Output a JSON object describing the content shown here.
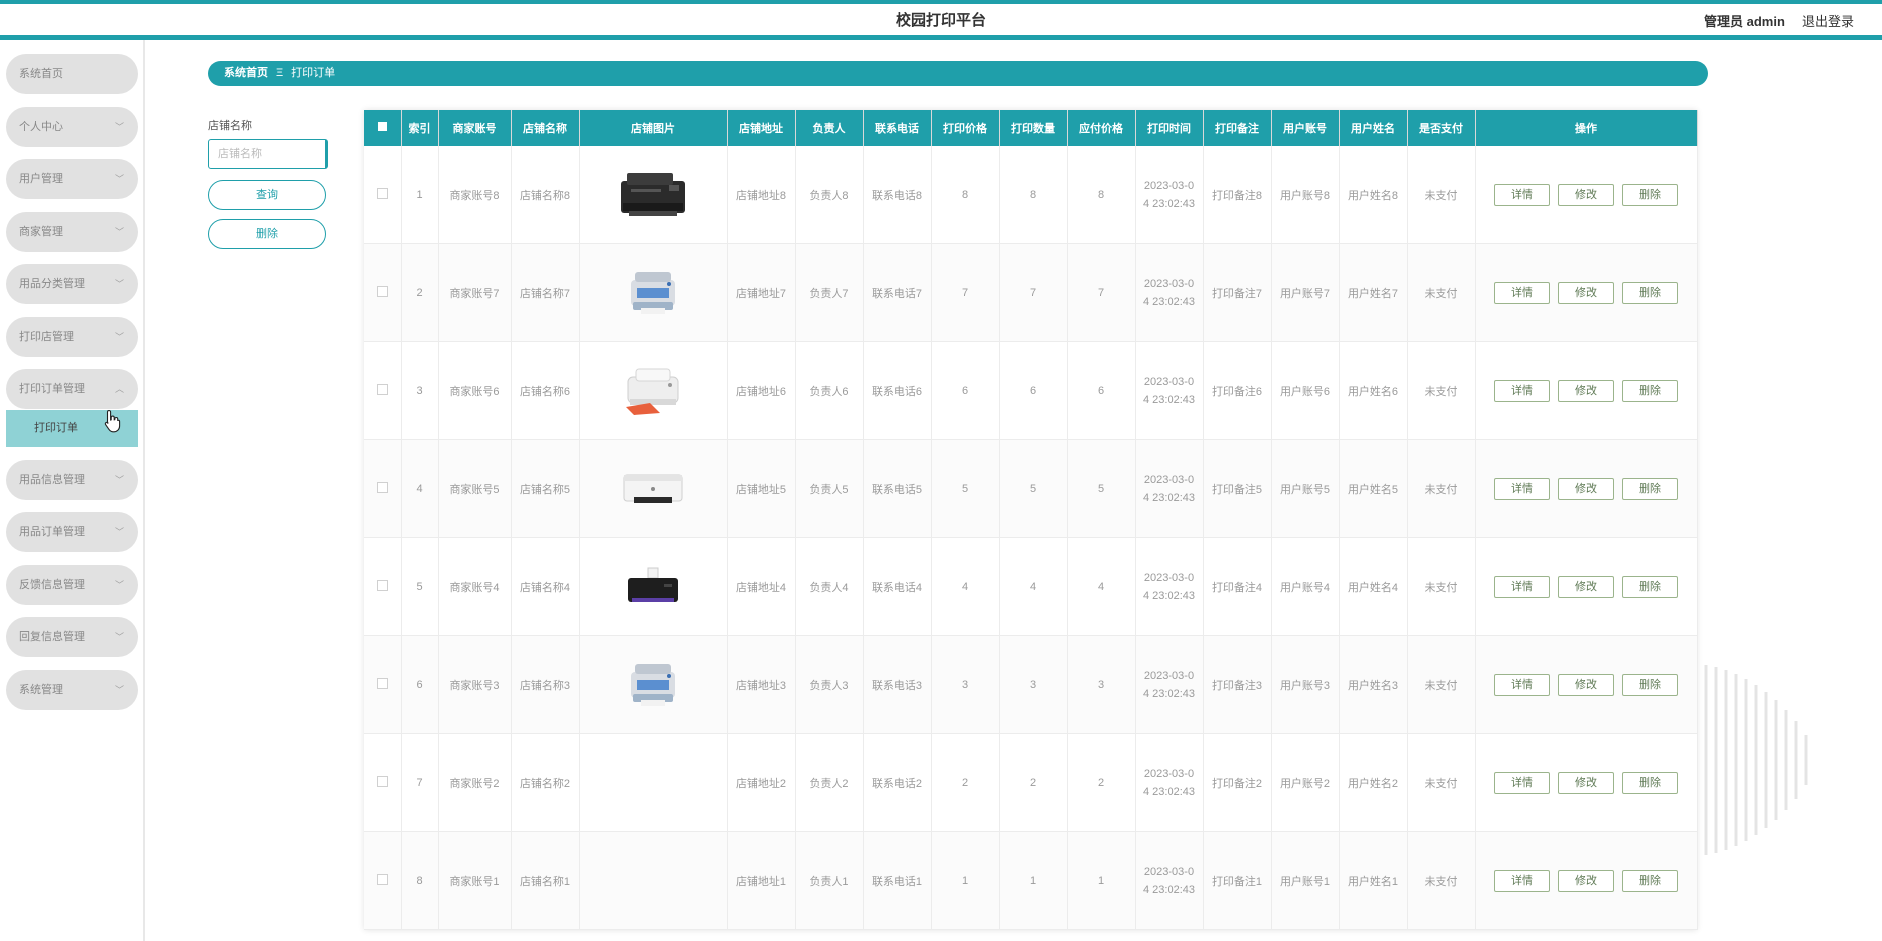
{
  "header": {
    "title": "校园打印平台",
    "user": "管理员 admin",
    "logout": "退出登录"
  },
  "colors": {
    "accent": "#1f9faa",
    "submenu_active": "#8fd2d5"
  },
  "sidebar": {
    "items": [
      {
        "label": "系统首页",
        "has_chevron": false
      },
      {
        "label": "个人中心",
        "has_chevron": true
      },
      {
        "label": "用户管理",
        "has_chevron": true
      },
      {
        "label": "商家管理",
        "has_chevron": true
      },
      {
        "label": "用品分类管理",
        "has_chevron": true
      },
      {
        "label": "打印店管理",
        "has_chevron": true
      },
      {
        "label": "打印订单管理",
        "has_chevron": true,
        "expanded": true
      },
      {
        "label": "用品信息管理",
        "has_chevron": true
      },
      {
        "label": "用品订单管理",
        "has_chevron": true
      },
      {
        "label": "反馈信息管理",
        "has_chevron": true
      },
      {
        "label": "回复信息管理",
        "has_chevron": true
      },
      {
        "label": "系统管理",
        "has_chevron": true
      }
    ],
    "submenu": {
      "label": "打印订单"
    }
  },
  "breadcrumb": {
    "home": "系统首页",
    "separator": "Ξ",
    "current": "打印订单"
  },
  "search": {
    "label": "店铺名称",
    "placeholder": "店铺名称",
    "query_button": "查询",
    "delete_button": "删除"
  },
  "table": {
    "columns": [
      "",
      "索引",
      "商家账号",
      "店铺名称",
      "店铺图片",
      "店铺地址",
      "负责人",
      "联系电话",
      "打印价格",
      "打印数量",
      "应付价格",
      "打印时间",
      "打印备注",
      "用户账号",
      "用户姓名",
      "是否支付",
      "操作"
    ],
    "actions": [
      "详情",
      "修改",
      "删除"
    ],
    "rows": [
      {
        "index": "1",
        "merchant": "商家账号8",
        "shop": "店铺名称8",
        "image": "printer-black-inkjet-icon",
        "address": "店铺地址8",
        "manager": "负责人8",
        "phone": "联系电话8",
        "price": "8",
        "qty": "8",
        "due": "8",
        "time1": "2023-03-0",
        "time2": "4 23:02:43",
        "note": "打印备注8",
        "user_account": "用户账号8",
        "user_name": "用户姓名8",
        "paid": "未支付"
      },
      {
        "index": "2",
        "merchant": "商家账号7",
        "shop": "店铺名称7",
        "image": "printer-blue-multifunction-icon",
        "address": "店铺地址7",
        "manager": "负责人7",
        "phone": "联系电话7",
        "price": "7",
        "qty": "7",
        "due": "7",
        "time1": "2023-03-0",
        "time2": "4 23:02:43",
        "note": "打印备注7",
        "user_account": "用户账号7",
        "user_name": "用户姓名7",
        "paid": "未支付"
      },
      {
        "index": "3",
        "merchant": "商家账号6",
        "shop": "店铺名称6",
        "image": "printer-white-inkjet-icon",
        "address": "店铺地址6",
        "manager": "负责人6",
        "phone": "联系电话6",
        "price": "6",
        "qty": "6",
        "due": "6",
        "time1": "2023-03-0",
        "time2": "4 23:02:43",
        "note": "打印备注6",
        "user_account": "用户账号6",
        "user_name": "用户姓名6",
        "paid": "未支付"
      },
      {
        "index": "4",
        "merchant": "商家账号5",
        "shop": "店铺名称5",
        "image": "printer-white-laser-icon",
        "address": "店铺地址5",
        "manager": "负责人5",
        "phone": "联系电话5",
        "price": "5",
        "qty": "5",
        "due": "5",
        "time1": "2023-03-0",
        "time2": "4 23:02:43",
        "note": "打印备注5",
        "user_account": "用户账号5",
        "user_name": "用户姓名5",
        "paid": "未支付"
      },
      {
        "index": "5",
        "merchant": "商家账号4",
        "shop": "店铺名称4",
        "image": "printer-black-photo-icon",
        "address": "店铺地址4",
        "manager": "负责人4",
        "phone": "联系电话4",
        "price": "4",
        "qty": "4",
        "due": "4",
        "time1": "2023-03-0",
        "time2": "4 23:02:43",
        "note": "打印备注4",
        "user_account": "用户账号4",
        "user_name": "用户姓名4",
        "paid": "未支付"
      },
      {
        "index": "6",
        "merchant": "商家账号3",
        "shop": "店铺名称3",
        "image": "printer-blue-multifunction-icon",
        "address": "店铺地址3",
        "manager": "负责人3",
        "phone": "联系电话3",
        "price": "3",
        "qty": "3",
        "due": "3",
        "time1": "2023-03-0",
        "time2": "4 23:02:43",
        "note": "打印备注3",
        "user_account": "用户账号3",
        "user_name": "用户姓名3",
        "paid": "未支付"
      },
      {
        "index": "7",
        "merchant": "商家账号2",
        "shop": "店铺名称2",
        "image": "",
        "address": "店铺地址2",
        "manager": "负责人2",
        "phone": "联系电话2",
        "price": "2",
        "qty": "2",
        "due": "2",
        "time1": "2023-03-0",
        "time2": "4 23:02:43",
        "note": "打印备注2",
        "user_account": "用户账号2",
        "user_name": "用户姓名2",
        "paid": "未支付"
      },
      {
        "index": "8",
        "merchant": "商家账号1",
        "shop": "店铺名称1",
        "image": "",
        "address": "店铺地址1",
        "manager": "负责人1",
        "phone": "联系电话1",
        "price": "1",
        "qty": "1",
        "due": "1",
        "time1": "2023-03-0",
        "time2": "4 23:02:43",
        "note": "打印备注1",
        "user_account": "用户账号1",
        "user_name": "用户姓名1",
        "paid": "未支付"
      }
    ]
  }
}
